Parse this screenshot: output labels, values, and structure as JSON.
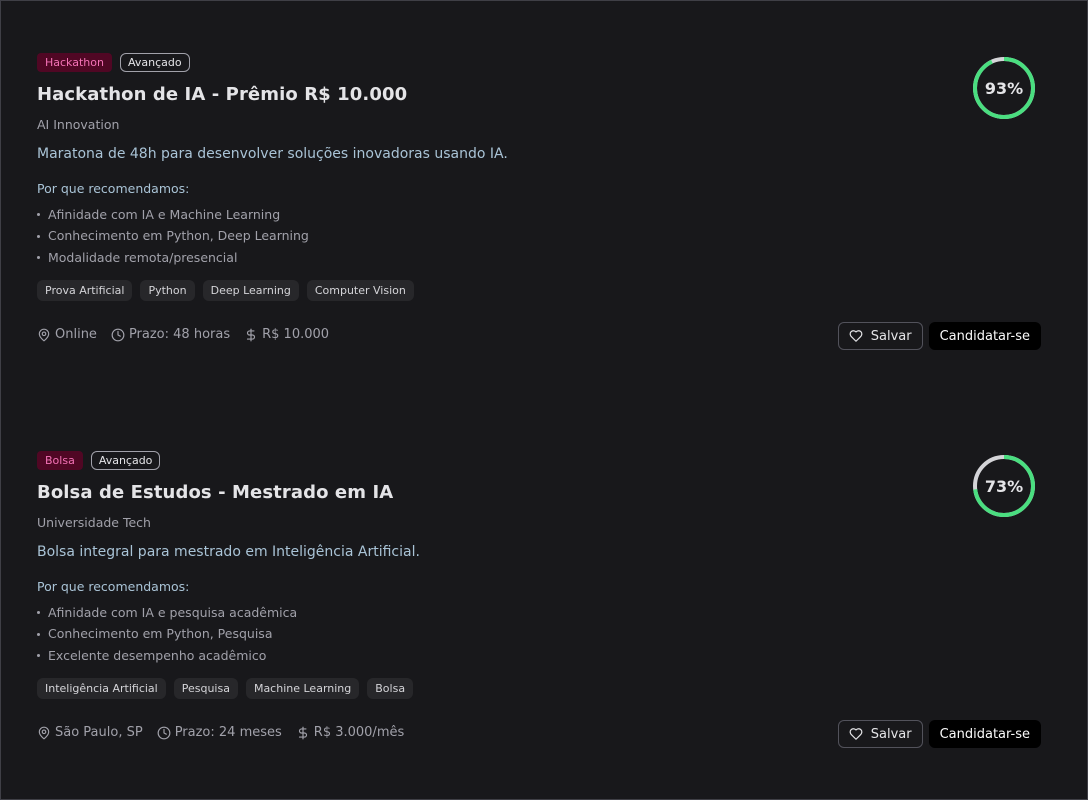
{
  "cards": [
    {
      "type_badge": "Hackathon",
      "level_badge": "Avançado",
      "title": "Hackathon de IA - Prêmio R$ 10.000",
      "organization": "AI Innovation",
      "description": "Maratona de 48h para desenvolver soluções inovadoras usando IA.",
      "why_title": "Por que recomendamos:",
      "reasons": [
        "Afinidade com IA e Machine Learning",
        "Conhecimento em Python, Deep Learning",
        "Modalidade remota/presencial"
      ],
      "tags": [
        "Prova Artificial",
        "Python",
        "Deep Learning",
        "Computer Vision"
      ],
      "location": "Online",
      "deadline": "Prazo: 48 horas",
      "value": "R$ 10.000",
      "save_label": "Salvar",
      "apply_label": "Candidatar-se",
      "match_percent": 93,
      "match_label": "93%"
    },
    {
      "type_badge": "Bolsa",
      "level_badge": "Avançado",
      "title": "Bolsa de Estudos - Mestrado em IA",
      "organization": "Universidade Tech",
      "description": "Bolsa integral para mestrado em Inteligência Artificial.",
      "why_title": "Por que recomendamos:",
      "reasons": [
        "Afinidade com IA e pesquisa acadêmica",
        "Conhecimento em Python, Pesquisa",
        "Excelente desempenho acadêmico"
      ],
      "tags": [
        "Inteligência Artificial",
        "Pesquisa",
        "Machine Learning",
        "Bolsa"
      ],
      "location": "São Paulo, SP",
      "deadline": "Prazo: 24 meses",
      "value": "R$ 3.000/mês",
      "save_label": "Salvar",
      "apply_label": "Candidatar-se",
      "match_percent": 73,
      "match_label": "73%"
    }
  ],
  "colors": {
    "background": "#18181b",
    "type_badge_bg": "#500724",
    "type_badge_text": "#f472b6",
    "score_ring": "#4ade80",
    "score_track": "#d4d4d8",
    "apply_button_bg": "#000000"
  },
  "icons": {
    "location": "map-pin-icon",
    "deadline": "clock-icon",
    "value": "dollar-icon",
    "save": "heart-icon"
  }
}
